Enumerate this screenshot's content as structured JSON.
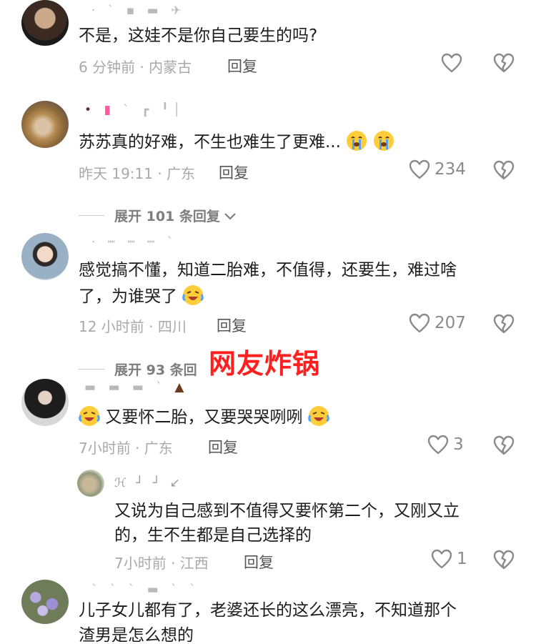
{
  "overlay_caption": "网友炸锅",
  "comments": [
    {
      "text": "不是，这娃不是你自己要生的吗?",
      "meta": "6 分钟前 · 内蒙古",
      "reply": "回复",
      "likes": ""
    },
    {
      "text": "苏苏真的好难，不生也难生了更难...",
      "meta": "昨天 19:11 · 广东",
      "reply": "回复",
      "likes": "234",
      "expand": "展开 101 条回复"
    },
    {
      "text_line1": "感觉搞不懂，知道二胎难，不值得，还要生，难过啥",
      "text_line2": "了，为谁哭了",
      "meta": "12 小时前 · 四川",
      "reply": "回复",
      "likes": "207",
      "expand": "展开 93 条回"
    },
    {
      "text_before": "又要怀二胎，又要哭哭咧咧",
      "meta": "7小时前 · 广东",
      "reply": "回复",
      "likes": "3",
      "sub_reply": {
        "text_line1": "又说为自己感到不值得又要怀第二个，又刚又立",
        "text_line2": "的，生不生都是自己选择的",
        "meta": "7小时前 · 江西",
        "reply": "回复",
        "likes": "1"
      }
    },
    {
      "text_line1": "儿子女儿都有了，老婆还长的这么漂亮，不知道那个",
      "text_line2": "渣男是怎么想的"
    }
  ],
  "icons": {
    "like": "heart-outline-icon",
    "dislike": "broken-heart-icon",
    "expand": "chevron-down-icon"
  },
  "colors": {
    "overlay": "#ff1f1f",
    "meta": "#a9a9a9",
    "text": "#1c1c1c"
  }
}
